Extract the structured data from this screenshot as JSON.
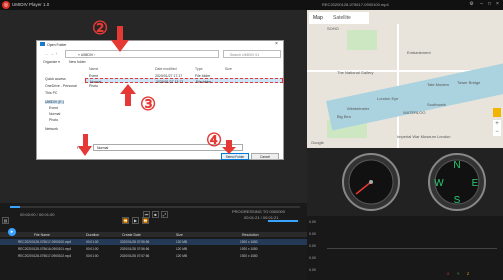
{
  "app": {
    "title": "UMIDIV Player 1.0",
    "file": "REC20200128-075617-0900100.mp4"
  },
  "dialog": {
    "title": "Open Folder",
    "address": "« UMIDIV  ›",
    "search_placeholder": "Search UMIDIV 01",
    "organize": "Organize ▾",
    "new_folder": "New folder",
    "nav_items": [
      "Quick access",
      "OneDrive - Personal",
      "This PC",
      "UMIDIV (E:)",
      "Event",
      "Normal",
      "Photo",
      "Network"
    ],
    "columns": [
      "Name",
      "Date modified",
      "Type",
      "Size"
    ],
    "rows": [
      {
        "name": "Event",
        "date": "2020/01/27 17:17",
        "type": "File folder"
      },
      {
        "name": "Normal",
        "date": "2020/01/27 17:17",
        "type": "File folder"
      },
      {
        "name": "Photo",
        "date": "",
        "type": ""
      }
    ],
    "folder_label": "Folder:",
    "folder_value": "Normal",
    "select_button": "Select Folder",
    "cancel_button": "Cancel"
  },
  "markers": [
    "②",
    "③",
    "④"
  ],
  "map": {
    "tab_map": "Map",
    "tab_sat": "Satellite",
    "labels": [
      "SOHO",
      "Embankment",
      "London Eye",
      "The National Gallery",
      "Westminster",
      "Big Ben",
      "Southwark",
      "WATERLOO",
      "Imperial War Museum London",
      "Tower Bridge",
      "Tate Modern",
      "Google"
    ]
  },
  "controls": {
    "time_left": "00:00:00 / 00:01:00",
    "time_right": "PROGRESSING TO 0000000",
    "time_right2": "00:01:21 / 00:01:21"
  },
  "graph": {
    "levels": [
      "0.00",
      "0.00",
      "0.00",
      "0.00",
      "0.00"
    ],
    "legend": [
      "X",
      "Y",
      "Z"
    ]
  },
  "table": {
    "columns": [
      "File Name",
      "Duration",
      "Create Date",
      "Size",
      "Resolution"
    ],
    "rows": [
      [
        "REC20200128-075617-0900100.mp4",
        "00:01:00",
        "2020/01/28 07:55:56",
        "120 MB",
        "1920 x 1080"
      ],
      [
        "REC20200128-075616-0900101.mp4",
        "00:01:00",
        "2020/01/28 07:56:56",
        "120 MB",
        "1920 x 1080"
      ],
      [
        "REC20200128-075617-0900102.mp4",
        "00:01:00",
        "2020/01/28 07:57:56",
        "120 MB",
        "1920 x 1080"
      ]
    ]
  },
  "colors": {
    "accent": "#3aa3ff",
    "annotation": "#e53935",
    "logo": "#d93025"
  }
}
